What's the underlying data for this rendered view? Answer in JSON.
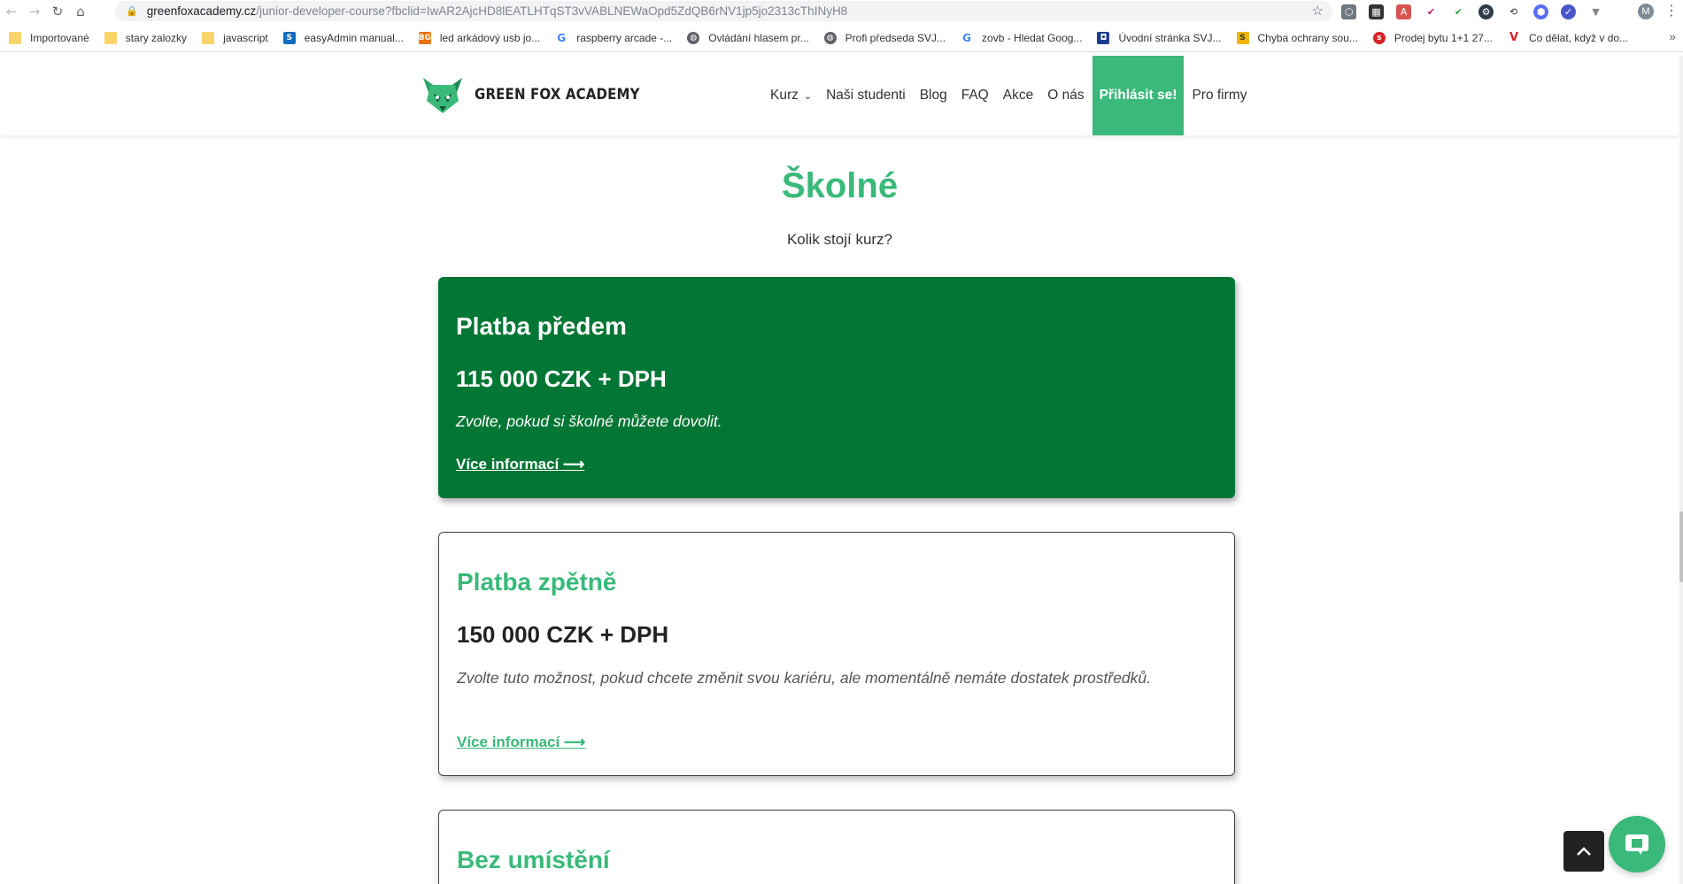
{
  "browser": {
    "url_domain": "greenfoxacademy.cz",
    "url_path": "/junior-developer-course?fbclid=IwAR2AjcHD8lEATLHTqST3vVABLNEWaOpd5ZdQB6rNV1jp5jo2313cThINyH8",
    "profile_initial": "M",
    "bookmarks": [
      {
        "label": "Importované",
        "icon": "folder-icon"
      },
      {
        "label": "stary zalozky",
        "icon": "folder-icon"
      },
      {
        "label": "javascript",
        "icon": "folder-icon"
      },
      {
        "label": "easyAdmin manual...",
        "icon": "sharepoint-icon"
      },
      {
        "label": "led arkádový usb jo...",
        "icon": "bg-icon"
      },
      {
        "label": "raspberry arcade -...",
        "icon": "google-icon"
      },
      {
        "label": "Ovládání hlasem pr...",
        "icon": "globe-icon"
      },
      {
        "label": "Profi předseda SVJ...",
        "icon": "globe-icon"
      },
      {
        "label": "zovb - Hledat Goog...",
        "icon": "google-icon"
      },
      {
        "label": "Úvodní stránka SVJ...",
        "icon": "site-icon"
      },
      {
        "label": "Chyba ochrany sou...",
        "icon": "sss-icon"
      },
      {
        "label": "Prodej bytu 1+1 27...",
        "icon": "sreality-icon"
      },
      {
        "label": "Co dělat, když v do...",
        "icon": "v-icon"
      }
    ]
  },
  "header": {
    "logo_text": "GREEN FOX ACADEMY",
    "nav": {
      "kurz": "Kurz",
      "studenti": "Naši studenti",
      "blog": "Blog",
      "faq": "FAQ",
      "akce": "Akce",
      "onas": "O nás",
      "prihlasit": "Přihlásit se!",
      "firmy": "Pro firmy"
    }
  },
  "main": {
    "title": "Školné",
    "subtitle": "Kolik stojí kurz?",
    "cards": [
      {
        "title": "Platba předem",
        "price": "115 000 CZK + DPH",
        "desc": "Zvolte, pokud si školné můžete dovolit.",
        "link": "Více informací ⟶"
      },
      {
        "title": "Platba zpětně",
        "price": "150 000 CZK + DPH",
        "desc": "Zvolte tuto možnost, pokud chcete změnit svou kariéru, ale momentálně nemáte dostatek prostředků.",
        "link": "Více informací ⟶"
      },
      {
        "title": "Bez umístění"
      }
    ]
  },
  "colors": {
    "brand_green": "#3ab97a",
    "dark_green": "#027634"
  }
}
